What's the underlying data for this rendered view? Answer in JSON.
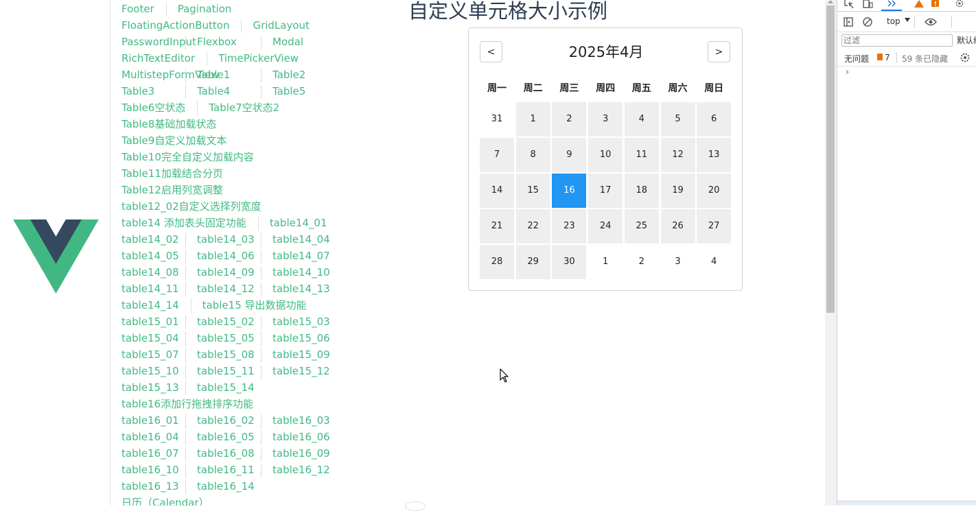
{
  "page": {
    "title": "自定义单元格大小示例"
  },
  "nav": {
    "rows": [
      [
        "Footer",
        "Pagination"
      ],
      [
        "FloatingActionButton",
        "GridLayout"
      ],
      [
        "PasswordInput",
        "Flexbox",
        "Modal"
      ],
      [
        "RichTextEditor",
        "TimePickerView"
      ],
      [
        "MultistepFormView",
        "Table1",
        "Table2"
      ],
      [
        "Table3",
        "Table4",
        "Table5"
      ],
      [
        "Table6空状态",
        "Table7空状态2"
      ],
      [
        "Table8基础加载状态"
      ],
      [
        "Table9自定义加载文本"
      ],
      [
        "Table10完全自定义加载内容"
      ],
      [
        "Table11加载结合分页"
      ],
      [
        "Table12启用列宽调整"
      ],
      [
        "table12_02自定义选择列宽度"
      ],
      [
        "table14 添加表头固定功能",
        "table14_01"
      ],
      [
        "table14_02",
        "table14_03",
        "table14_04"
      ],
      [
        "table14_05",
        "table14_06",
        "table14_07"
      ],
      [
        "table14_08",
        "table14_09",
        "table14_10"
      ],
      [
        "table14_11",
        "table14_12",
        "table14_13"
      ],
      [
        "table14_14",
        "table15 导出数据功能"
      ],
      [
        "table15_01",
        "table15_02",
        "table15_03"
      ],
      [
        "table15_04",
        "table15_05",
        "table15_06"
      ],
      [
        "table15_07",
        "table15_08",
        "table15_09"
      ],
      [
        "table15_10",
        "table15_11",
        "table15_12"
      ],
      [
        "table15_13",
        "table15_14"
      ],
      [
        "table16添加行拖拽排序功能"
      ],
      [
        "table16_01",
        "table16_02",
        "table16_03"
      ],
      [
        "table16_04",
        "table16_05",
        "table16_06"
      ],
      [
        "table16_07",
        "table16_08",
        "table16_09"
      ],
      [
        "table16_10",
        "table16_11",
        "table16_12"
      ],
      [
        "table16_13",
        "table16_14"
      ],
      [
        "日历（Calendar）"
      ]
    ]
  },
  "calendar": {
    "prev_label": "<",
    "next_label": ">",
    "title": "2025年4月",
    "weekdays": [
      "周一",
      "周二",
      "周三",
      "周四",
      "周五",
      "周六",
      "周日"
    ],
    "selected_day": "16",
    "weeks": [
      [
        {
          "d": "31",
          "cur": false
        },
        {
          "d": "1",
          "cur": true
        },
        {
          "d": "2",
          "cur": true
        },
        {
          "d": "3",
          "cur": true
        },
        {
          "d": "4",
          "cur": true
        },
        {
          "d": "5",
          "cur": true
        },
        {
          "d": "6",
          "cur": true
        }
      ],
      [
        {
          "d": "7",
          "cur": true
        },
        {
          "d": "8",
          "cur": true
        },
        {
          "d": "9",
          "cur": true
        },
        {
          "d": "10",
          "cur": true
        },
        {
          "d": "11",
          "cur": true
        },
        {
          "d": "12",
          "cur": true
        },
        {
          "d": "13",
          "cur": true
        }
      ],
      [
        {
          "d": "14",
          "cur": true
        },
        {
          "d": "15",
          "cur": true
        },
        {
          "d": "16",
          "cur": true
        },
        {
          "d": "17",
          "cur": true
        },
        {
          "d": "18",
          "cur": true
        },
        {
          "d": "19",
          "cur": true
        },
        {
          "d": "20",
          "cur": true
        }
      ],
      [
        {
          "d": "21",
          "cur": true
        },
        {
          "d": "22",
          "cur": true
        },
        {
          "d": "23",
          "cur": true
        },
        {
          "d": "24",
          "cur": true
        },
        {
          "d": "25",
          "cur": true
        },
        {
          "d": "26",
          "cur": true
        },
        {
          "d": "27",
          "cur": true
        }
      ],
      [
        {
          "d": "28",
          "cur": true
        },
        {
          "d": "29",
          "cur": true
        },
        {
          "d": "30",
          "cur": true
        },
        {
          "d": "1",
          "cur": false
        },
        {
          "d": "2",
          "cur": false
        },
        {
          "d": "3",
          "cur": false
        },
        {
          "d": "4",
          "cur": false
        }
      ]
    ]
  },
  "devtools": {
    "context": "top",
    "filter_placeholder": "过滤",
    "default_levels": "默认级",
    "no_issues": "无问题",
    "issue_count": "7",
    "hidden_count": "59 条已隐藏",
    "prompt": "›"
  },
  "colors": {
    "link": "#42b983",
    "selected": "#2196f3",
    "cell_bg": "#eeeeee",
    "vue_green": "#41b883",
    "vue_dark": "#34495e"
  }
}
